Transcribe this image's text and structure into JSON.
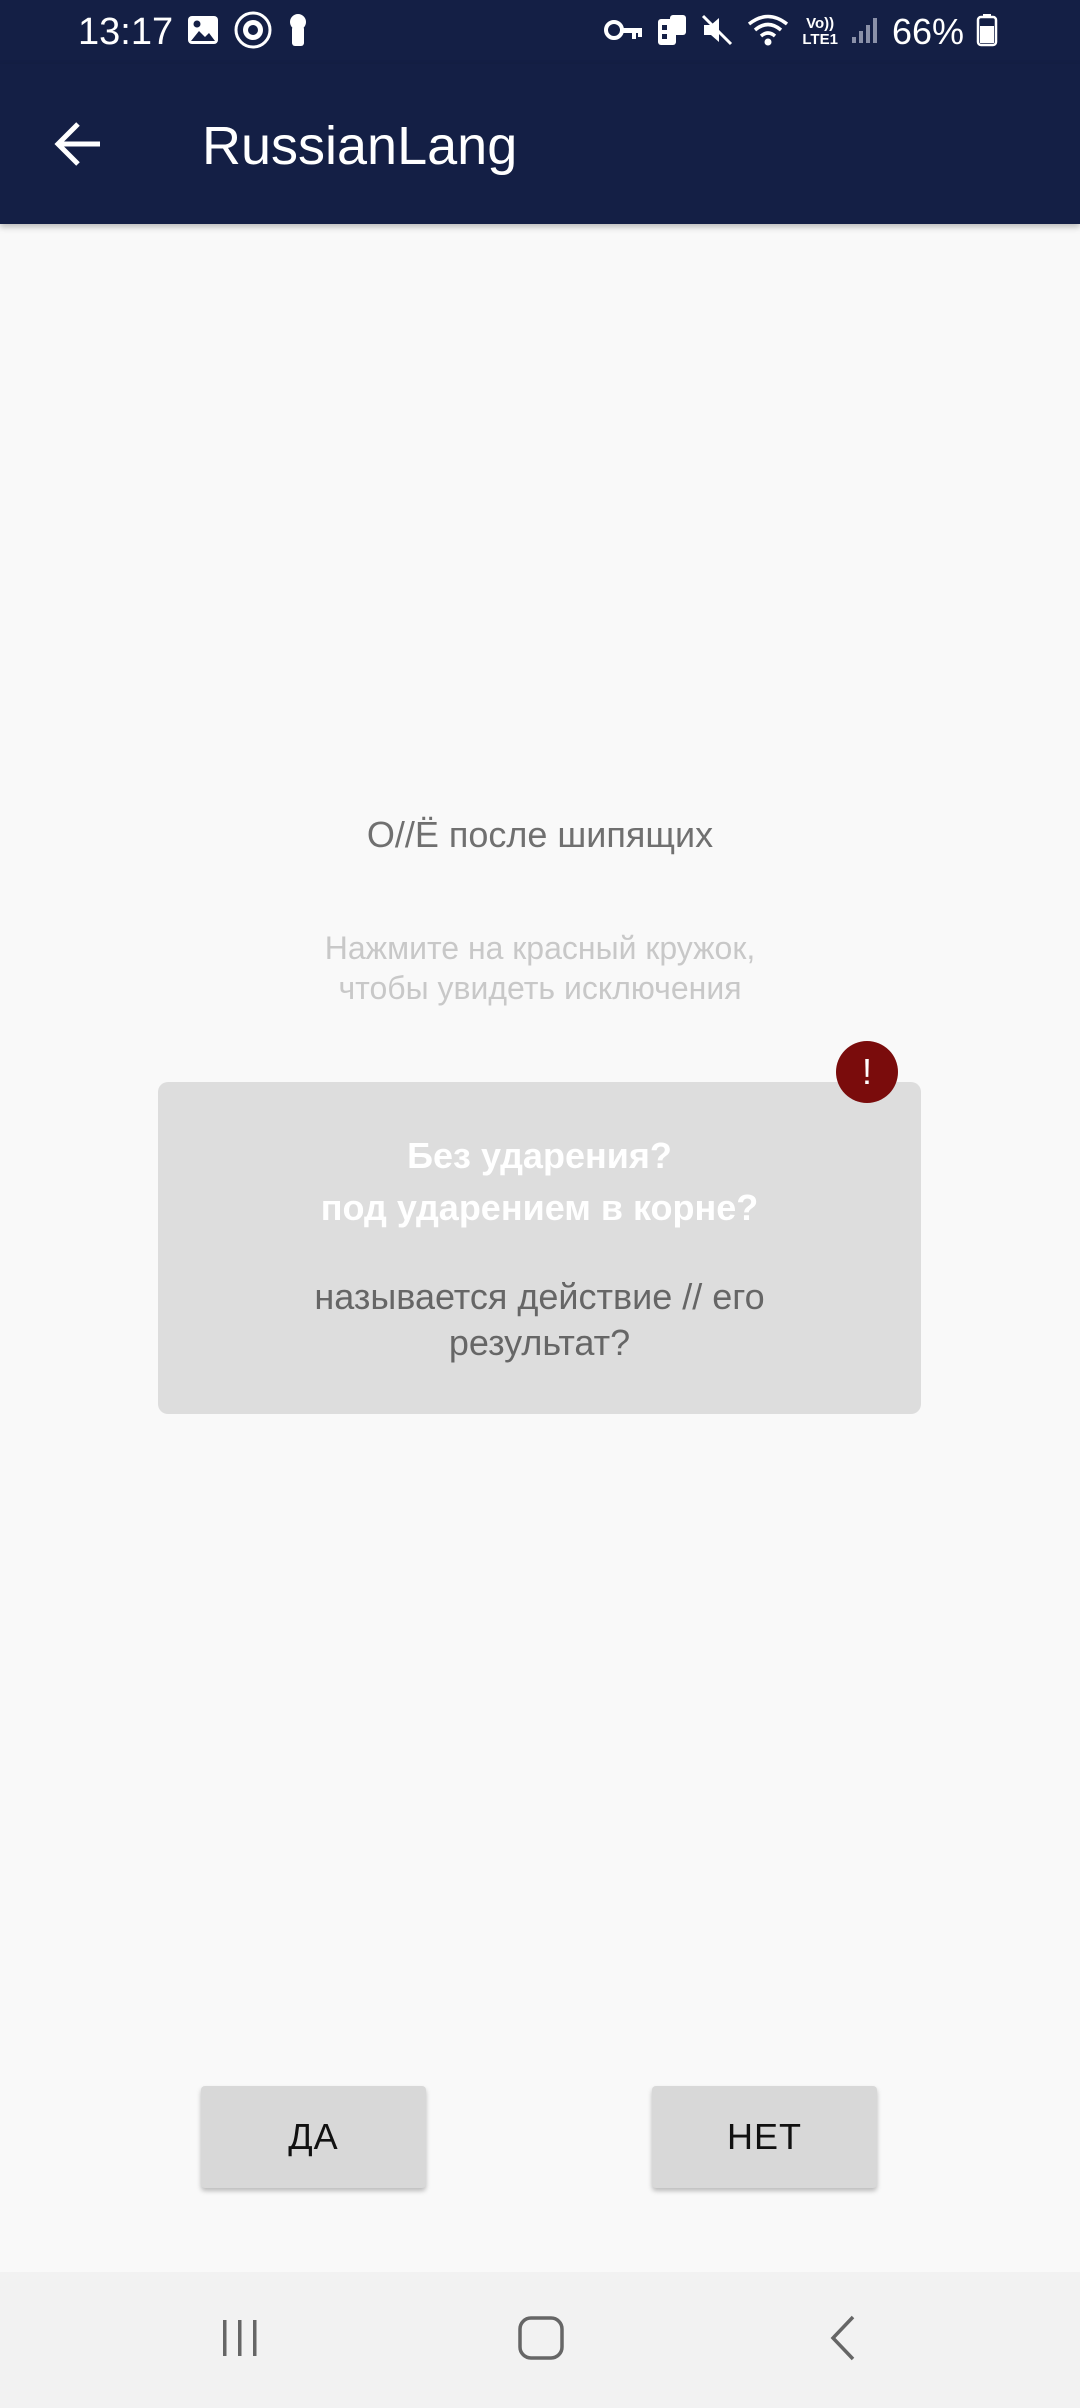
{
  "status_bar": {
    "time": "13:17",
    "battery": "66%",
    "left_icons": [
      "image-icon",
      "browser-icon",
      "keyhole-icon"
    ],
    "right_icons": [
      "vpn-key-icon",
      "data-saver-icon",
      "mute-icon",
      "wifi-icon",
      "volte-icon",
      "signal-icon",
      "battery-icon"
    ],
    "volte_label_top": "Vo))",
    "volte_label_bottom": "LTE1"
  },
  "app_bar": {
    "title": "RussianLang",
    "back_icon": "arrow-left-icon"
  },
  "content": {
    "topic": "О//Ё после шипящих",
    "hint_line1": "Нажмите на красный кружок,",
    "hint_line2": "чтобы увидеть исключения",
    "card": {
      "question_line1": "Без ударения?",
      "question_line2": "под ударением в корне?",
      "question_line3": "называется действие // его результат?"
    },
    "exceptions_badge": "!"
  },
  "buttons": {
    "yes_label": "ДА",
    "no_label": "НЕТ"
  },
  "nav_bar": {
    "icons": [
      "recents-icon",
      "home-icon",
      "back-icon"
    ]
  },
  "colors": {
    "app_bar": "#141f45",
    "badge": "#7a0c0c",
    "card": "#dddddd",
    "button": "#d8d8d8"
  }
}
